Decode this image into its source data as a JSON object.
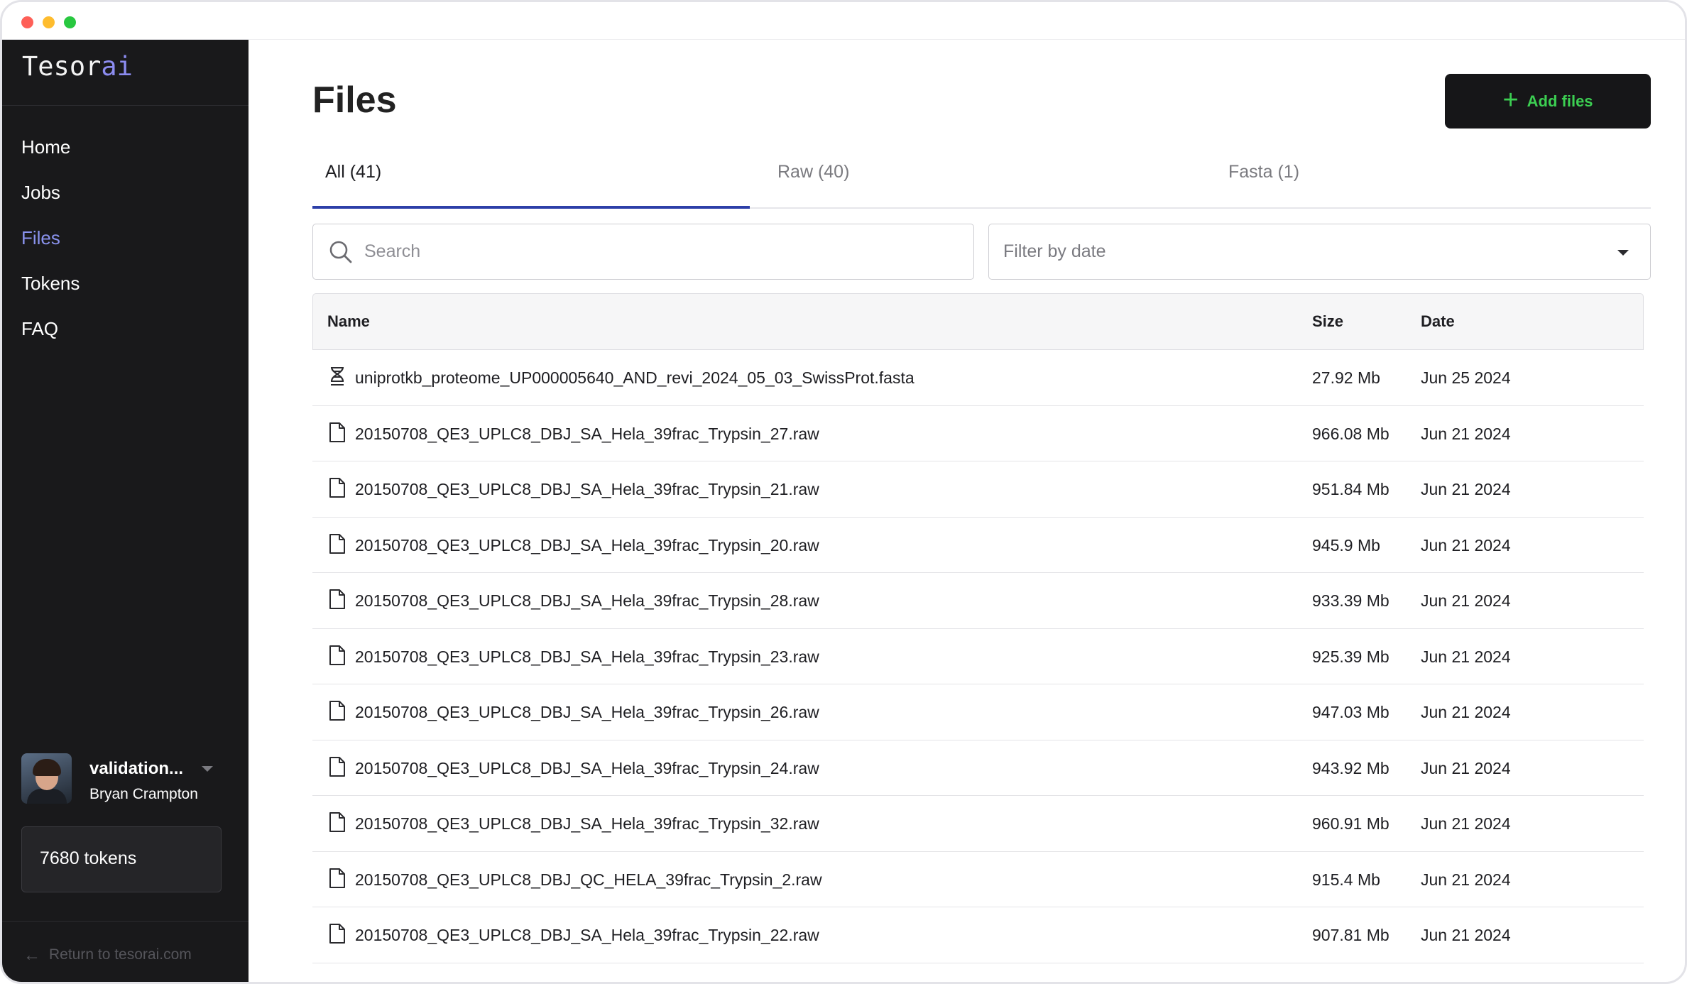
{
  "app": {
    "logo_main": "Tesor",
    "logo_accent": "ai"
  },
  "sidebar": {
    "items": [
      {
        "label": "Home"
      },
      {
        "label": "Jobs"
      },
      {
        "label": "Files"
      },
      {
        "label": "Tokens"
      },
      {
        "label": "FAQ"
      }
    ],
    "active": "Files",
    "user": {
      "org": "validation...",
      "name": "Bryan Crampton"
    },
    "tokens": "7680 tokens",
    "return_link": "Return to tesorai.com"
  },
  "page": {
    "title": "Files",
    "add_button": "Add files"
  },
  "tabs": [
    {
      "label": "All (41)"
    },
    {
      "label": "Raw (40)"
    },
    {
      "label": "Fasta (1)"
    }
  ],
  "search": {
    "placeholder": "Search",
    "value": ""
  },
  "filter": {
    "placeholder": "Filter by date"
  },
  "table": {
    "headers": {
      "name": "Name",
      "size": "Size",
      "date": "Date"
    },
    "rows": [
      {
        "type": "fasta",
        "name": "uniprotkb_proteome_UP000005640_AND_revi_2024_05_03_SwissProt.fasta",
        "size": "27.92 Mb",
        "date": "Jun 25 2024"
      },
      {
        "type": "raw",
        "name": "20150708_QE3_UPLC8_DBJ_SA_Hela_39frac_Trypsin_27.raw",
        "size": "966.08 Mb",
        "date": "Jun 21 2024"
      },
      {
        "type": "raw",
        "name": "20150708_QE3_UPLC8_DBJ_SA_Hela_39frac_Trypsin_21.raw",
        "size": "951.84 Mb",
        "date": "Jun 21 2024"
      },
      {
        "type": "raw",
        "name": "20150708_QE3_UPLC8_DBJ_SA_Hela_39frac_Trypsin_20.raw",
        "size": "945.9 Mb",
        "date": "Jun 21 2024"
      },
      {
        "type": "raw",
        "name": "20150708_QE3_UPLC8_DBJ_SA_Hela_39frac_Trypsin_28.raw",
        "size": "933.39 Mb",
        "date": "Jun 21 2024"
      },
      {
        "type": "raw",
        "name": "20150708_QE3_UPLC8_DBJ_SA_Hela_39frac_Trypsin_23.raw",
        "size": "925.39 Mb",
        "date": "Jun 21 2024"
      },
      {
        "type": "raw",
        "name": "20150708_QE3_UPLC8_DBJ_SA_Hela_39frac_Trypsin_26.raw",
        "size": "947.03 Mb",
        "date": "Jun 21 2024"
      },
      {
        "type": "raw",
        "name": "20150708_QE3_UPLC8_DBJ_SA_Hela_39frac_Trypsin_24.raw",
        "size": "943.92 Mb",
        "date": "Jun 21 2024"
      },
      {
        "type": "raw",
        "name": "20150708_QE3_UPLC8_DBJ_SA_Hela_39frac_Trypsin_32.raw",
        "size": "960.91 Mb",
        "date": "Jun 21 2024"
      },
      {
        "type": "raw",
        "name": "20150708_QE3_UPLC8_DBJ_QC_HELA_39frac_Trypsin_2.raw",
        "size": "915.4 Mb",
        "date": "Jun 21 2024"
      },
      {
        "type": "raw",
        "name": "20150708_QE3_UPLC8_DBJ_SA_Hela_39frac_Trypsin_22.raw",
        "size": "907.81 Mb",
        "date": "Jun 21 2024"
      }
    ]
  },
  "colors": {
    "sidebar_bg": "#19191b",
    "active_nav": "#8a93ee",
    "accent_green": "#3ccf52",
    "tab_underline": "#2d3fa8"
  },
  "icons": {
    "fasta": "dna-icon",
    "raw": "file-icon",
    "search": "search-icon",
    "add": "plus-icon"
  }
}
